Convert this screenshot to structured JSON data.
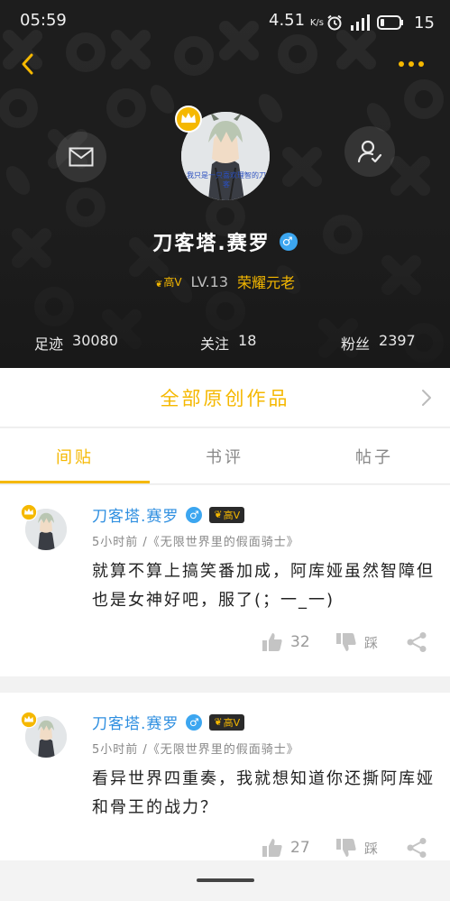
{
  "status_bar": {
    "time": "05:59",
    "speed_value": "4.51",
    "speed_unit": "K/s",
    "battery": "15"
  },
  "profile": {
    "username": "刀客塔.赛罗",
    "gender_symbol": "♂",
    "vip_label": "高V",
    "level": "LV.13",
    "level_title": "荣耀元老",
    "avatar_caption": "我只是一只喜欢理智的刀客"
  },
  "stats": [
    {
      "label": "足迹",
      "value": "30080"
    },
    {
      "label": "关注",
      "value": "18"
    },
    {
      "label": "粉丝",
      "value": "2397"
    }
  ],
  "works": {
    "title": "全部原创作品"
  },
  "tabs": [
    {
      "label": "间贴",
      "active": true
    },
    {
      "label": "书评",
      "active": false
    },
    {
      "label": "帖子",
      "active": false
    }
  ],
  "posts": [
    {
      "author": "刀客塔.赛罗",
      "gender_symbol": "♂",
      "vip_label": "高V",
      "meta": "5小时前 /《无限世界里的假面骑士》",
      "body": "就算不算上搞笑番加成，阿库娅虽然智障但也是女神好吧，服了(；一_一)",
      "likes": "32",
      "dislike_label": "踩"
    },
    {
      "author": "刀客塔.赛罗",
      "gender_symbol": "♂",
      "vip_label": "高V",
      "meta": "5小时前 /《无限世界里的假面骑士》",
      "body": "看异世界四重奏，我就想知道你还撕阿库娅和骨王的战力？",
      "likes": "27",
      "dislike_label": "踩"
    }
  ],
  "colors": {
    "accent": "#f5b800",
    "header_bg": "#1d1d1d",
    "author_blue": "#2f8fe0",
    "gender_blue": "#3ca6f0"
  },
  "icons": [
    "back-arrow-icon",
    "more-dots-icon",
    "mail-icon",
    "follow-user-icon",
    "crown-icon",
    "thumbs-up-icon",
    "thumbs-down-icon",
    "share-icon",
    "chevron-right-icon",
    "alarm-icon",
    "signal-icon",
    "battery-icon"
  ]
}
